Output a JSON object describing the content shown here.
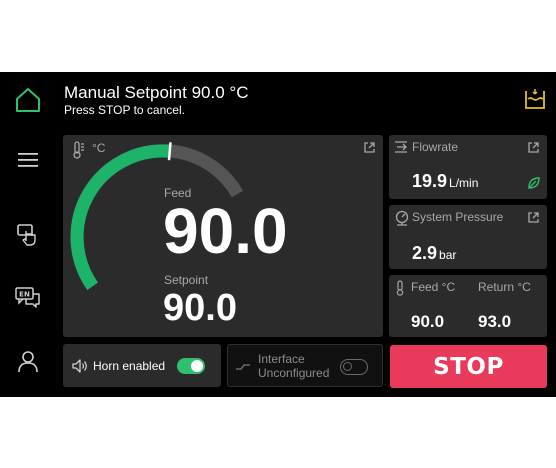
{
  "header": {
    "title": "Manual Setpoint 90.0 °C",
    "subtitle": "Press STOP to cancel."
  },
  "nav": {
    "items": [
      "home-icon",
      "menu-icon",
      "touch-icon",
      "language-icon",
      "user-icon"
    ]
  },
  "main_panel": {
    "unit_label": "°C",
    "feed_label": "Feed",
    "feed_value": "90.0",
    "setpoint_label": "Setpoint",
    "setpoint_value": "90.0",
    "gauge_level": 0.7,
    "colors": {
      "arc_active": "#1db46a",
      "arc_track": "#555555"
    }
  },
  "flowrate": {
    "label": "Flowrate",
    "value": "19.9",
    "unit": "L/min"
  },
  "pressure": {
    "label": "System Pressure",
    "value": "2.9",
    "unit": "bar"
  },
  "temps": {
    "feed_label": "Feed °C",
    "feed_value": "90.0",
    "return_label": "Return °C",
    "return_value": "93.0"
  },
  "horn": {
    "label": "Horn enabled",
    "enabled": true
  },
  "interface": {
    "line1": "Interface",
    "line2": "Unconfigured",
    "enabled": false
  },
  "stop_label": "STOP",
  "colors": {
    "accent": "#2fbf6f",
    "stop": "#e93a5c",
    "warning": "#e2c02a"
  }
}
